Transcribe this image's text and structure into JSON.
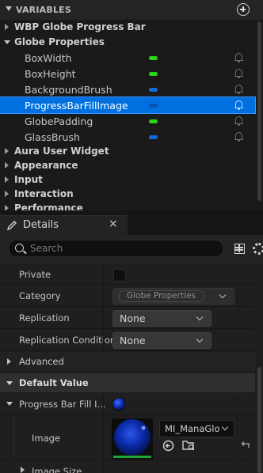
{
  "variables_panel": {
    "header_title": "VARIABLES",
    "categories": [
      {
        "label": "WBP Globe Progress Bar",
        "expanded": false
      },
      {
        "label": "Globe Properties",
        "expanded": true
      },
      {
        "label": "Aura User Widget",
        "expanded": false
      },
      {
        "label": "Appearance",
        "expanded": false
      },
      {
        "label": "Input",
        "expanded": false
      },
      {
        "label": "Interaction",
        "expanded": false
      },
      {
        "label": "Performance",
        "expanded": false
      }
    ],
    "variables": [
      {
        "name": "BoxWidth",
        "type_color": "#29d616",
        "selected": false
      },
      {
        "name": "BoxHeight",
        "type_color": "#29d616",
        "selected": false
      },
      {
        "name": "BackgroundBrush",
        "type_color": "#1168d8",
        "selected": false
      },
      {
        "name": "ProgressBarFillImage",
        "type_color": "#1168d8",
        "selected": true
      },
      {
        "name": "GlobePadding",
        "type_color": "#29d616",
        "selected": false
      },
      {
        "name": "GlassBrush",
        "type_color": "#1168d8",
        "selected": false
      }
    ]
  },
  "details_panel": {
    "tab_label": "Details",
    "tab_close": "×",
    "search_placeholder": "Search",
    "properties": {
      "private_label": "Private",
      "private_checked": false,
      "category_label": "Category",
      "category_value": "Globe Properties",
      "replication_label": "Replication",
      "replication_value": "None",
      "replication_condition_label": "Replication Condition",
      "replication_condition_value": "None"
    },
    "sections": {
      "advanced": "Advanced",
      "default_value": "Default Value"
    },
    "default_value": {
      "progress_bar_fill_label": "Progress Bar Fill I...",
      "image_label": "Image",
      "image_asset": "MI_ManaGlo",
      "image_size_label": "Image Size"
    }
  },
  "colors": {
    "selection": "#0070e0",
    "float_pin": "#29d616",
    "struct_pin": "#1168d8"
  }
}
